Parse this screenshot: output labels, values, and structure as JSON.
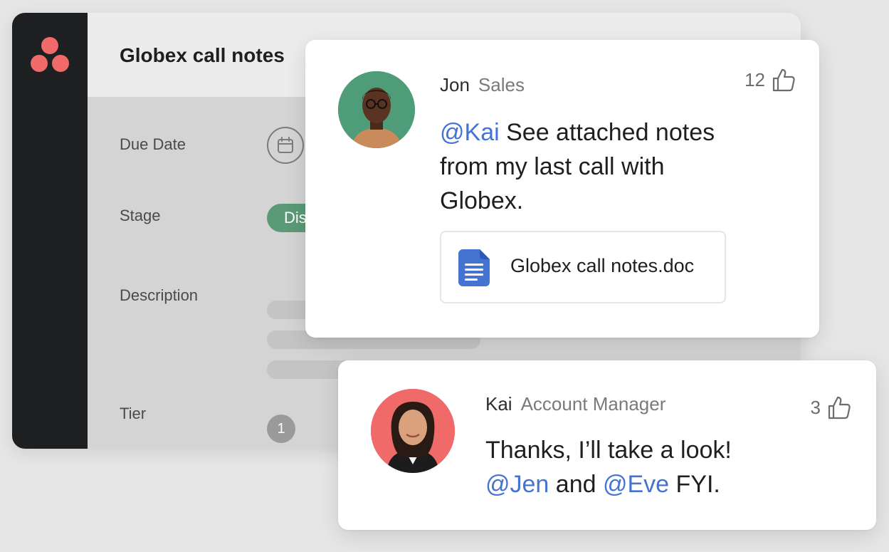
{
  "app": {
    "logo_icon": "asana-logo-icon",
    "brand_color": "#f06a6a",
    "sidebar_color": "#1e1f21"
  },
  "task": {
    "title": "Globex call notes",
    "fields": [
      {
        "label": "Due Date",
        "icon": "calendar-icon"
      },
      {
        "label": "Stage",
        "value": "Dis"
      },
      {
        "label": "Description"
      },
      {
        "label": "Tier",
        "value": "1"
      }
    ]
  },
  "comments": [
    {
      "author": "Jon",
      "role": "Sales",
      "likes": "12",
      "like_icon": "thumbs-up-icon",
      "avatar_color": "#4e9c78",
      "message_parts": {
        "mention": "@Kai",
        "text": " See attached notes from my last call with Globex."
      },
      "attachment": {
        "icon": "document-icon",
        "icon_color": "#4573d2",
        "name": "Globex call notes.doc"
      }
    },
    {
      "author": "Kai",
      "role": "Account Manager",
      "likes": "3",
      "like_icon": "thumbs-up-icon",
      "avatar_color": "#f06a6a",
      "message_parts": {
        "text1": "Thanks, I’ll take a look!",
        "mention1": "@Jen",
        "text2": " and ",
        "mention2": "@Eve",
        "text3": " FYI."
      }
    }
  ],
  "colors": {
    "mention": "#4573d2",
    "stage_pill": "#5a9a76"
  }
}
